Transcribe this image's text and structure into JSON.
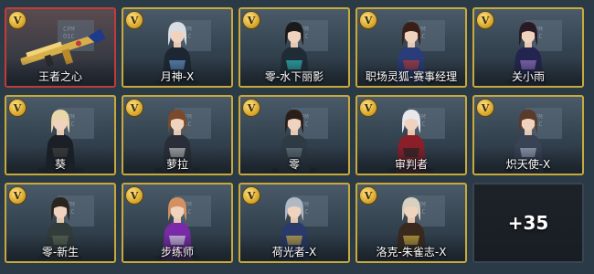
{
  "badge_letter": "V",
  "bg_sign": "CFM\nO1C",
  "more_label": "+35",
  "items": [
    {
      "name": "王者之心",
      "kind": "weapon",
      "frame": "red"
    },
    {
      "name": "月神-X",
      "kind": "char",
      "hair": "#d8dde3",
      "suit": "#1d2733",
      "accent": "#6aa0d8"
    },
    {
      "name": "零-水下丽影",
      "kind": "char",
      "hair": "#1a1a1a",
      "suit": "#1f2b35",
      "accent": "#2ec7c9"
    },
    {
      "name": "职场灵狐-赛事经理",
      "kind": "char",
      "hair": "#3a1f18",
      "suit": "#2a3c7a",
      "accent": "#c23b3b"
    },
    {
      "name": "关小雨",
      "kind": "char",
      "hair": "#2a1a24",
      "suit": "#242450",
      "accent": "#9b7bd1"
    },
    {
      "name": "葵",
      "kind": "char",
      "hair": "#e9d7a8",
      "suit": "#1b1f26",
      "accent": "#444"
    },
    {
      "name": "萝拉",
      "kind": "char",
      "hair": "#7a4a2a",
      "suit": "#2a2e38",
      "accent": "#c9c9c9"
    },
    {
      "name": "零",
      "kind": "char",
      "hair": "#2a1e18",
      "suit": "#2e3a44",
      "accent": "#6b7a86"
    },
    {
      "name": "审判者",
      "kind": "char",
      "hair": "#e8e8ec",
      "suit": "#8a1f2a",
      "accent": "#222"
    },
    {
      "name": "炽天使-X",
      "kind": "char",
      "hair": "#5a3a2a",
      "suit": "#3a4256",
      "accent": "#aab4c8"
    },
    {
      "name": "零-新生",
      "kind": "char",
      "hair": "#2a241e",
      "suit": "#323c3a",
      "accent": "#5d6b58"
    },
    {
      "name": "步练师",
      "kind": "char",
      "hair": "#d49060",
      "suit": "#7a2aa8",
      "accent": "#e0e0f0"
    },
    {
      "name": "荷光者-X",
      "kind": "char",
      "hair": "#b0b8c4",
      "suit": "#2a3a6a",
      "accent": "#d8b64a"
    },
    {
      "name": "洛克-朱雀志-X",
      "kind": "char",
      "hair": "#d8d0c0",
      "suit": "#3a2a1e",
      "accent": "#d8b640"
    }
  ]
}
